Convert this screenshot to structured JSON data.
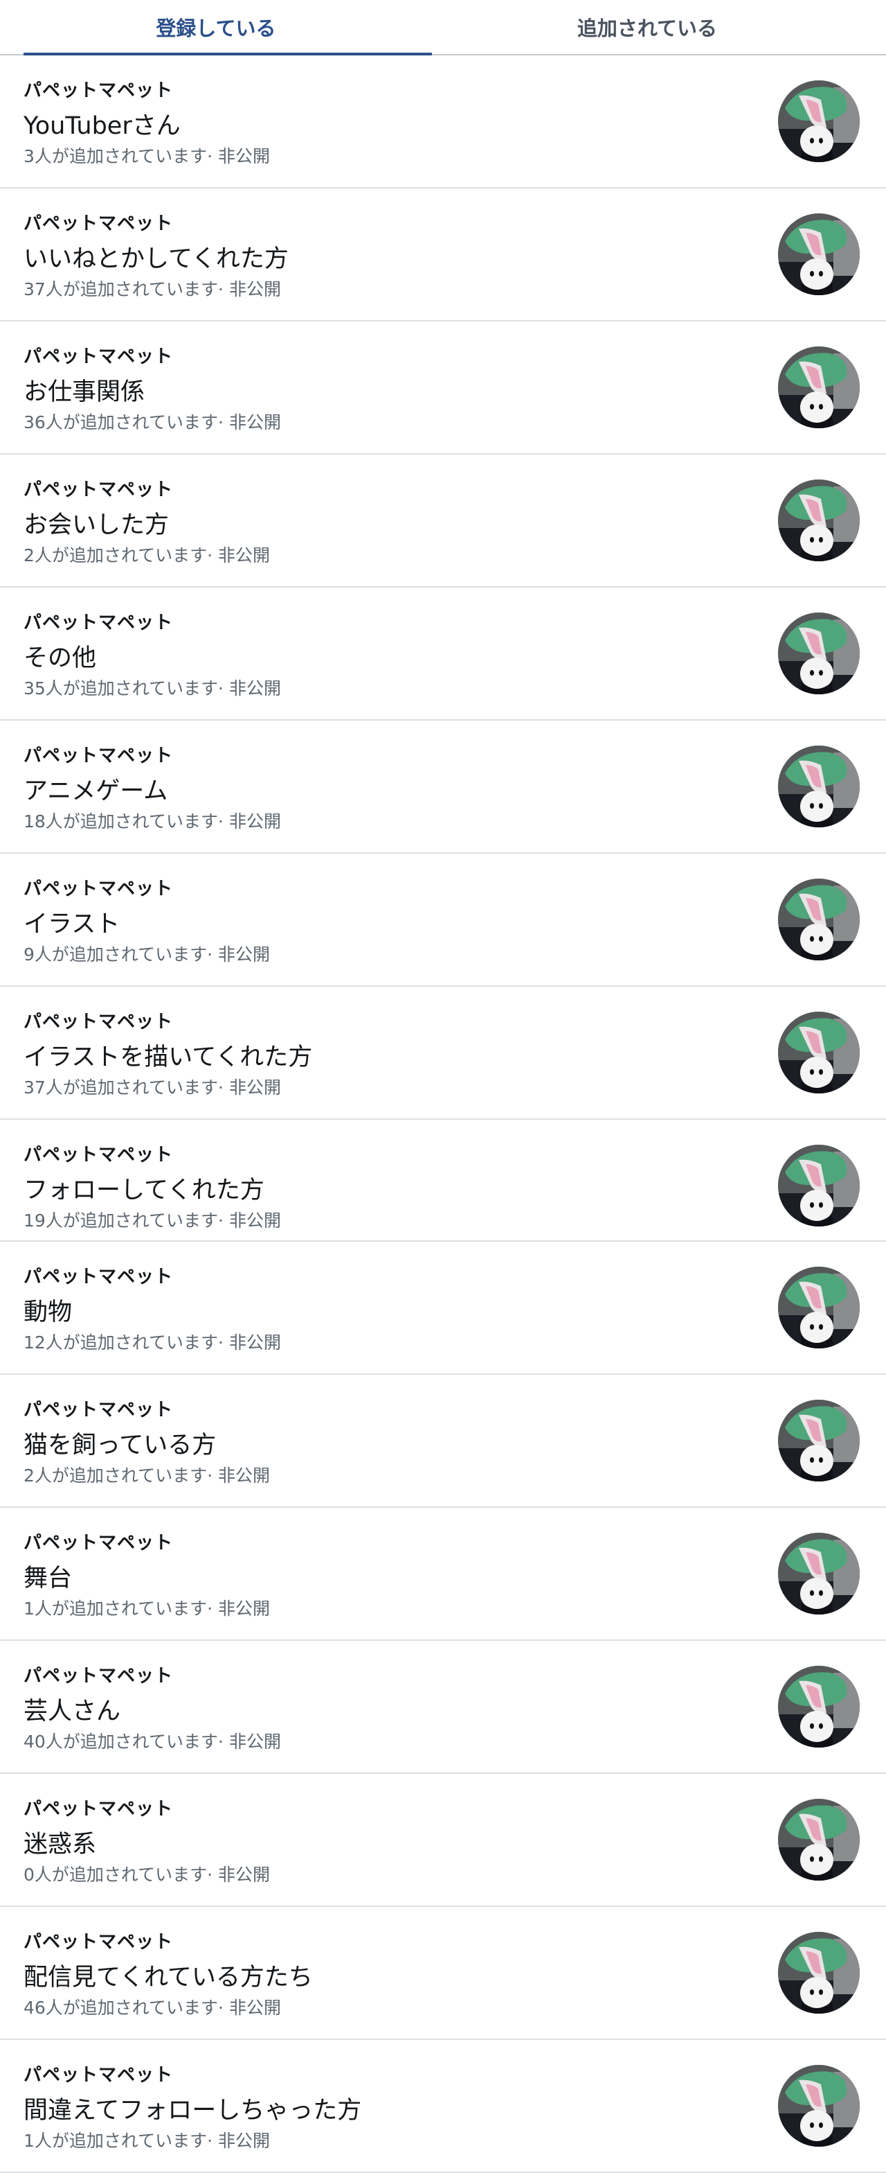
{
  "tabs": [
    {
      "label": "登録している",
      "active": true
    },
    {
      "label": "追加されている",
      "active": false
    }
  ],
  "lists": [
    {
      "owner": "パペットマペット",
      "name": "YouTuberさん",
      "members": "3人が追加されています· 非公開"
    },
    {
      "owner": "パペットマペット",
      "name": "いいねとかしてくれた方",
      "members": "37人が追加されています· 非公開"
    },
    {
      "owner": "パペットマペット",
      "name": "お仕事関係",
      "members": "36人が追加されています· 非公開"
    },
    {
      "owner": "パペットマペット",
      "name": "お会いした方",
      "members": "2人が追加されています· 非公開"
    },
    {
      "owner": "パペットマペット",
      "name": "その他",
      "members": "35人が追加されています· 非公開"
    },
    {
      "owner": "パペットマペット",
      "name": "アニメゲーム",
      "members": "18人が追加されています· 非公開"
    },
    {
      "owner": "パペットマペット",
      "name": "イラスト",
      "members": "9人が追加されています· 非公開"
    },
    {
      "owner": "パペットマペット",
      "name": "イラストを描いてくれた方",
      "members": "37人が追加されています· 非公開"
    },
    {
      "owner": "パペットマペット",
      "name": "フォローしてくれた方",
      "members": "19人が追加されています· 非公開"
    },
    {
      "owner": "パペットマペット",
      "name": "動物",
      "members": "12人が追加されています· 非公開"
    },
    {
      "owner": "パペットマペット",
      "name": "猫を飼っている方",
      "members": "2人が追加されています· 非公開"
    },
    {
      "owner": "パペットマペット",
      "name": "舞台",
      "members": "1人が追加されています· 非公開"
    },
    {
      "owner": "パペットマペット",
      "name": "芸人さん",
      "members": "40人が追加されています· 非公開"
    },
    {
      "owner": "パペットマペット",
      "name": "迷惑系",
      "members": "0人が追加されています· 非公開"
    },
    {
      "owner": "パペットマペット",
      "name": "配信見てくれている方たち",
      "members": "46人が追加されています· 非公開"
    },
    {
      "owner": "パペットマペット",
      "name": "間違えてフォローしちゃった方",
      "members": "1人が追加されています· 非公開"
    }
  ],
  "colors": {
    "active_tab": "#2b4f8a",
    "tab_underline": "#2d4f8c",
    "muted_text": "#5e6770",
    "divider": "#dcdfe2"
  },
  "icons": {
    "list_avatar": "puppet-avatar-icon"
  }
}
